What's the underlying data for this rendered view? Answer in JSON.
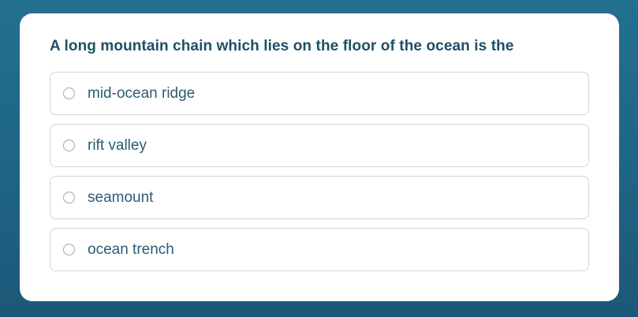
{
  "question": {
    "text": "A long mountain chain which lies on the floor of the ocean is the"
  },
  "options": [
    {
      "label": "mid-ocean ridge"
    },
    {
      "label": "rift valley"
    },
    {
      "label": "seamount"
    },
    {
      "label": "ocean trench"
    }
  ],
  "colors": {
    "background": "#1f6485",
    "card": "#ffffff",
    "question_text": "#1f4f66",
    "option_text": "#2b5c73",
    "option_border": "#cfd6dc"
  },
  "icons": {
    "option_marker": "radio-unchecked-icon"
  }
}
